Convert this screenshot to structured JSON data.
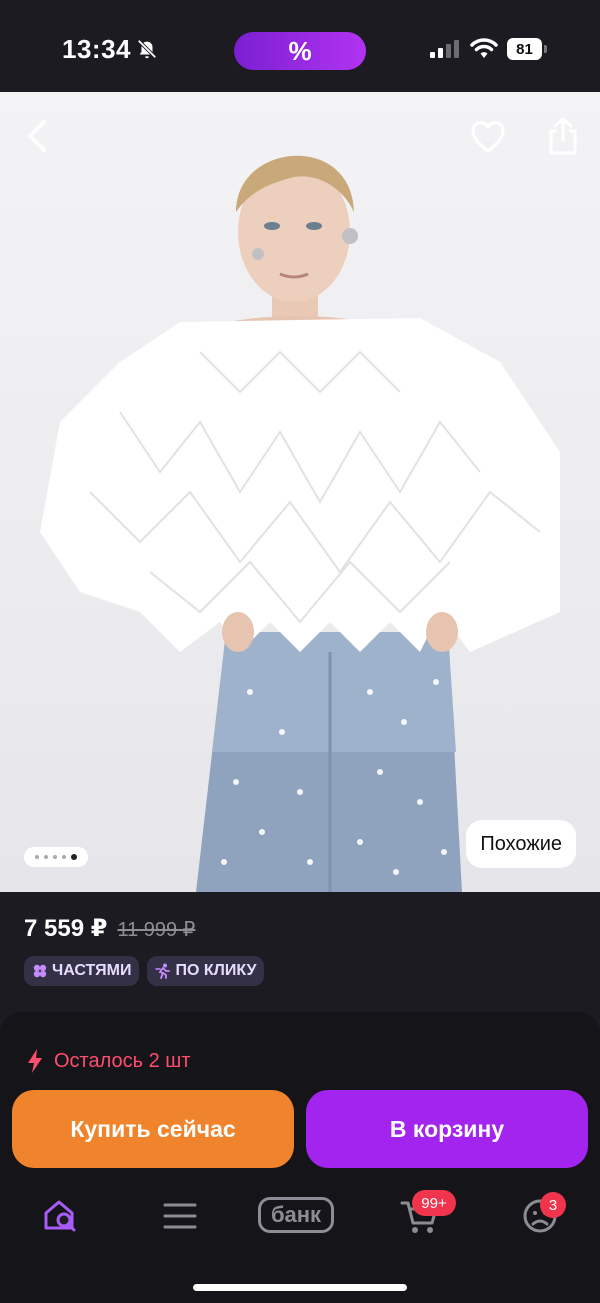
{
  "status_bar": {
    "time": "13:34",
    "promo_label": "%",
    "battery": "81",
    "icons": [
      "bell-off-icon",
      "signal-icon",
      "wifi-icon",
      "battery-icon"
    ]
  },
  "product": {
    "image_alt": "Product photo: white ruffled off-shoulder blouse and pearl-studded jeans",
    "gallery_total": 5,
    "gallery_active": 5,
    "similar_label": "Похожие",
    "icons": [
      "back-icon",
      "heart-icon",
      "share-icon"
    ]
  },
  "price": {
    "current": "7 559 ₽",
    "old": "11 999 ₽"
  },
  "badges": [
    {
      "label": "ЧАСТЯМИ",
      "icon": "parts-icon"
    },
    {
      "label": "ПО КЛИКУ",
      "icon": "runner-icon"
    }
  ],
  "stock": {
    "text": "Осталось 2 шт",
    "color": "#ff4d6d"
  },
  "actions": {
    "buy_now": "Купить сейчас",
    "add_to_cart": "В корзину",
    "buy_color": "#f0842c",
    "cart_color": "#a324ee"
  },
  "bottom_nav": {
    "bank_label": "банк",
    "cart_badge": "99+",
    "profile_badge": "3",
    "items": [
      "home-search-icon",
      "catalog-icon",
      "bank-icon",
      "cart-icon",
      "profile-icon"
    ]
  }
}
